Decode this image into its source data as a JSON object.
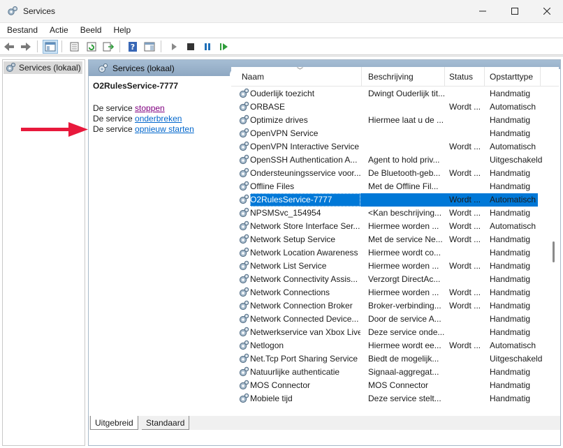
{
  "window": {
    "title": "Services"
  },
  "menu": [
    "Bestand",
    "Actie",
    "Beeld",
    "Help"
  ],
  "tree": {
    "root_label": "Services (lokaal)"
  },
  "pane": {
    "header": "Services (lokaal)"
  },
  "extended": {
    "service_name": "O2RulesService-7777",
    "stop_prefix": "De service ",
    "stop_link": "stoppen",
    "pause_prefix": "De service ",
    "pause_link": "onderbreken",
    "restart_prefix": "De service ",
    "restart_link": "opnieuw starten"
  },
  "columns": {
    "name": "Naam",
    "description": "Beschrijving",
    "status": "Status",
    "startup": "Opstarttype"
  },
  "rows": [
    {
      "name": "Ouderlijk toezicht",
      "description": "Dwingt Ouderlijk tit...",
      "status": "",
      "startup": "Handmatig"
    },
    {
      "name": "ORBASE",
      "description": "",
      "status": "Wordt ...",
      "startup": "Automatisch"
    },
    {
      "name": "Optimize drives",
      "description": "Hiermee laat u de ...",
      "status": "",
      "startup": "Handmatig"
    },
    {
      "name": "OpenVPN Service",
      "description": "",
      "status": "",
      "startup": "Handmatig"
    },
    {
      "name": "OpenVPN Interactive Service",
      "description": "",
      "status": "Wordt ...",
      "startup": "Automatisch"
    },
    {
      "name": "OpenSSH Authentication A...",
      "description": "Agent to hold priv...",
      "status": "",
      "startup": "Uitgeschakeld"
    },
    {
      "name": "Ondersteuningsservice voor...",
      "description": "De Bluetooth-geb...",
      "status": "Wordt ...",
      "startup": "Handmatig"
    },
    {
      "name": "Offline Files",
      "description": "Met de Offline Fil...",
      "status": "",
      "startup": "Handmatig"
    },
    {
      "name": "O2RulesService-7777",
      "description": "",
      "status": "Wordt ...",
      "startup": "Automatisch",
      "selected": true
    },
    {
      "name": "NPSMSvc_154954",
      "description": "<Kan beschrijving...",
      "status": "Wordt ...",
      "startup": "Handmatig"
    },
    {
      "name": "Network Store Interface Ser...",
      "description": "Hiermee worden ...",
      "status": "Wordt ...",
      "startup": "Automatisch"
    },
    {
      "name": "Network Setup Service",
      "description": "Met de service Ne...",
      "status": "Wordt ...",
      "startup": "Handmatig"
    },
    {
      "name": "Network Location Awareness",
      "description": "Hiermee wordt co...",
      "status": "",
      "startup": "Handmatig"
    },
    {
      "name": "Network List Service",
      "description": "Hiermee worden ...",
      "status": "Wordt ...",
      "startup": "Handmatig"
    },
    {
      "name": "Network Connectivity Assis...",
      "description": "Verzorgt DirectAc...",
      "status": "",
      "startup": "Handmatig"
    },
    {
      "name": "Network Connections",
      "description": "Hiermee worden ...",
      "status": "Wordt ...",
      "startup": "Handmatig"
    },
    {
      "name": "Network Connection Broker",
      "description": "Broker-verbinding...",
      "status": "Wordt ...",
      "startup": "Handmatig"
    },
    {
      "name": "Network Connected Device...",
      "description": "Door de service A...",
      "status": "",
      "startup": "Handmatig"
    },
    {
      "name": "Netwerkservice van Xbox Live",
      "description": "Deze service onde...",
      "status": "",
      "startup": "Handmatig"
    },
    {
      "name": "Netlogon",
      "description": "Hiermee wordt ee...",
      "status": "Wordt ...",
      "startup": "Automatisch"
    },
    {
      "name": "Net.Tcp Port Sharing Service",
      "description": "Biedt de mogelijk...",
      "status": "",
      "startup": "Uitgeschakeld"
    },
    {
      "name": "Natuurlijke authenticatie",
      "description": "Signaal-aggregat...",
      "status": "",
      "startup": "Handmatig"
    },
    {
      "name": "MOS Connector",
      "description": "MOS Connector",
      "status": "",
      "startup": "Handmatig"
    },
    {
      "name": "Mobiele tijd",
      "description": "Deze service stelt...",
      "status": "",
      "startup": "Handmatig"
    }
  ],
  "tabs": {
    "extended": "Uitgebreid",
    "standard": "Standaard"
  },
  "colors": {
    "selection": "#0078d7",
    "link": "#0066cc",
    "visited": "#800080",
    "arrow": "#e8193c",
    "header": "#9ab3cc"
  },
  "icons": {
    "window": "gear-icon",
    "row": "gear-icon",
    "arrow": "red-arrow"
  }
}
